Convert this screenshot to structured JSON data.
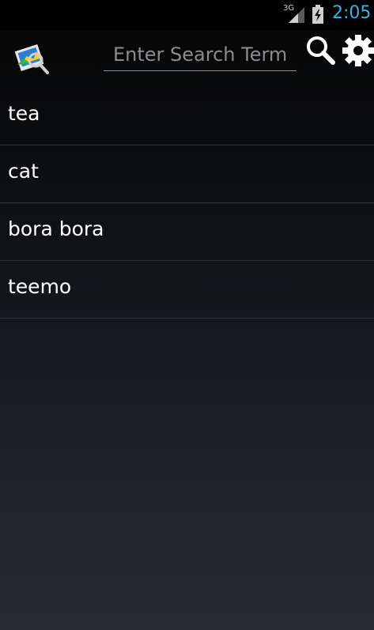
{
  "status_bar": {
    "network": "3G",
    "time": "2:05",
    "icons": [
      "signal-icon",
      "battery-charging-icon"
    ]
  },
  "action_bar": {
    "logo_icon": "photo-search-logo-icon",
    "search": {
      "value": "",
      "placeholder": "Enter Search Term"
    },
    "search_icon": "search-icon",
    "settings_icon": "gear-icon"
  },
  "history": {
    "items": [
      {
        "label": "tea"
      },
      {
        "label": "cat"
      },
      {
        "label": "bora bora"
      },
      {
        "label": "teemo"
      }
    ]
  },
  "colors": {
    "clock": "#33b5e5",
    "divider": "#2e3238",
    "text": "#ffffff"
  }
}
